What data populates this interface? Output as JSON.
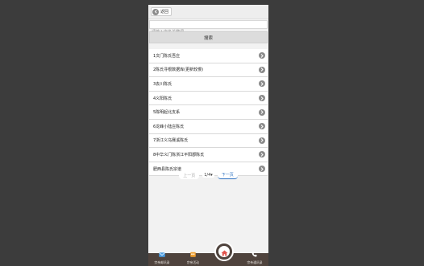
{
  "header": {
    "back_label": "返回"
  },
  "search": {
    "placeholder": "请输入店名关键词",
    "button_label": "搜索"
  },
  "list": {
    "items": [
      {
        "label": "1文门陈氏吾庄"
      },
      {
        "label": "2陈氏寻根数据库(更新较慢)"
      },
      {
        "label": "3去川陈氏"
      },
      {
        "label": "4义阳陈氏"
      },
      {
        "label": "5陈明起北支系"
      },
      {
        "label": "6龙峰小陆庄陈氏"
      },
      {
        "label": "7浙江义乌赛溪陈氏"
      },
      {
        "label": "8中华义门陈浙江平阳郡陈氏"
      },
      {
        "label": "肥西县陈氏宗谱"
      }
    ]
  },
  "pager": {
    "prev_label": "上一页",
    "page_select": "1/4",
    "next_label": "下一页"
  },
  "bottom_nav": {
    "left1_label": "宗亲邮讯录",
    "left2_label": "宗亲活动",
    "right_label": "宗亲通讯录"
  },
  "colors": {
    "nav_bg": "#4f433d",
    "home_icon": "#e2554e",
    "envelope_icon": "#4a9be0",
    "calendar_icon": "#f0a030",
    "link_blue": "#2a6fc0"
  }
}
